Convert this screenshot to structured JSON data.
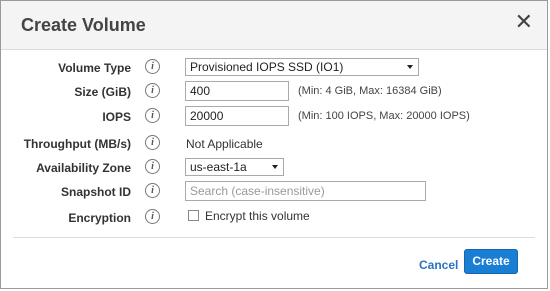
{
  "dialog": {
    "title": "Create Volume",
    "close_glyph": "✕"
  },
  "info_glyph": "i",
  "form": {
    "volume_type": {
      "label": "Volume Type",
      "value": "Provisioned IOPS SSD (IO1)"
    },
    "size": {
      "label": "Size (GiB)",
      "value": "400",
      "hint": "(Min: 4 GiB, Max: 16384 GiB)"
    },
    "iops": {
      "label": "IOPS",
      "value": "20000",
      "hint": "(Min: 100 IOPS, Max: 20000 IOPS)"
    },
    "throughput": {
      "label": "Throughput (MB/s)",
      "value": "Not Applicable"
    },
    "availability_zone": {
      "label": "Availability Zone",
      "value": "us-east-1a"
    },
    "snapshot_id": {
      "label": "Snapshot ID",
      "placeholder": "Search (case-insensitive)"
    },
    "encryption": {
      "label": "Encryption",
      "checkbox_label": "Encrypt this volume",
      "checked": false
    }
  },
  "footer": {
    "cancel_label": "Cancel",
    "create_label": "Create"
  },
  "colors": {
    "primary": "#1a7ed4",
    "link": "#2a73c1",
    "header_bg": "#f4f4f4"
  }
}
